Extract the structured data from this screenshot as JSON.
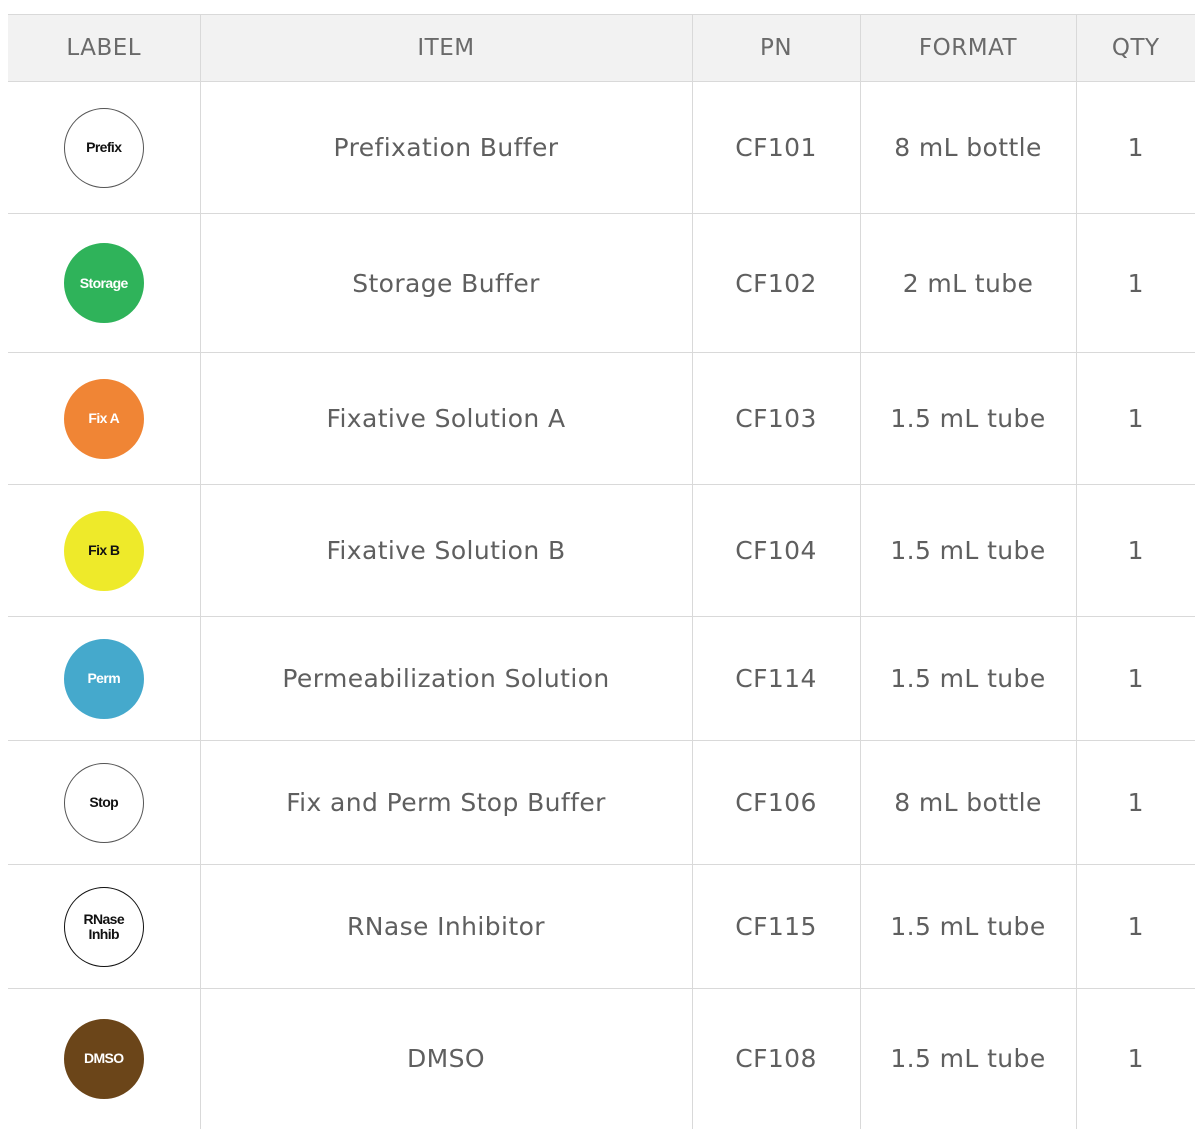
{
  "table": {
    "headers": [
      "LABEL",
      "ITEM",
      "PN",
      "FORMAT",
      "QTY"
    ],
    "rows": [
      {
        "label": "Prefix",
        "label_bg": "#ffffff",
        "label_text_color": "#111111",
        "label_border": "#555555",
        "item": "Prefixation Buffer",
        "pn": "CF101",
        "format": "8 mL bottle",
        "qty": "1"
      },
      {
        "label": "Storage",
        "label_bg": "#2fb35a",
        "label_text_color": "#ffffff",
        "label_border": "#2fb35a",
        "item": "Storage Buffer",
        "pn": "CF102",
        "format": "2 mL tube",
        "qty": "1"
      },
      {
        "label": "Fix A",
        "label_bg": "#f08535",
        "label_text_color": "#ffffff",
        "label_border": "#f08535",
        "item": "Fixative Solution A",
        "pn": "CF103",
        "format": "1.5 mL tube",
        "qty": "1"
      },
      {
        "label": "Fix B",
        "label_bg": "#eeea2a",
        "label_text_color": "#111111",
        "label_border": "#eeea2a",
        "item": "Fixative Solution B",
        "pn": "CF104",
        "format": "1.5 mL tube",
        "qty": "1"
      },
      {
        "label": "Perm",
        "label_bg": "#45a9cc",
        "label_text_color": "#ffffff",
        "label_border": "#45a9cc",
        "item": "Permeabilization Solution",
        "pn": "CF114",
        "format": "1.5 mL tube",
        "qty": "1"
      },
      {
        "label": "Stop",
        "label_bg": "#ffffff",
        "label_text_color": "#111111",
        "label_border": "#555555",
        "item": "Fix and Perm Stop Buffer",
        "pn": "CF106",
        "format": "8 mL bottle",
        "qty": "1"
      },
      {
        "label": "RNase\nInhib",
        "label_bg": "#ffffff",
        "label_text_color": "#111111",
        "label_border": "#111111",
        "item": "RNase Inhibitor",
        "pn": "CF115",
        "format": "1.5 mL tube",
        "qty": "1"
      },
      {
        "label": "DMSO",
        "label_bg": "#6b4519",
        "label_text_color": "#ffffff",
        "label_border": "#6b4519",
        "item": "DMSO",
        "pn": "CF108",
        "format": "1.5 mL tube",
        "qty": "1"
      }
    ]
  }
}
